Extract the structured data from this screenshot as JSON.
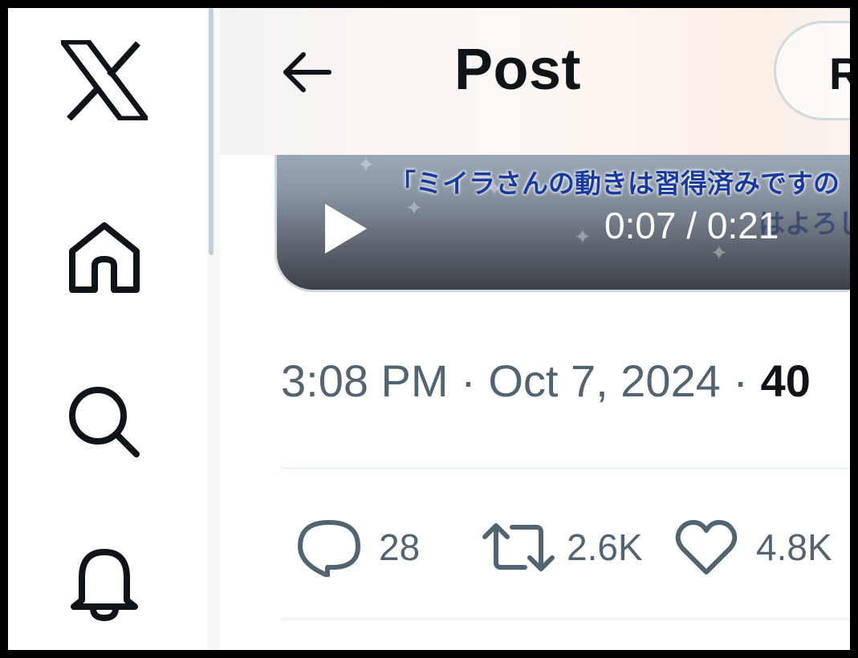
{
  "nav": {
    "logo": "x-logo-icon",
    "items": [
      {
        "name": "home",
        "icon": "home-icon"
      },
      {
        "name": "explore",
        "icon": "search-icon"
      },
      {
        "name": "notifications",
        "icon": "bell-icon"
      }
    ]
  },
  "header": {
    "title": "Post",
    "back_icon": "arrow-left-icon",
    "reply_button_label": "R"
  },
  "video": {
    "subtitle_line1": "「ミイラさんの動きは習得済みですの",
    "subtitle_line2": "はよろしい",
    "time": "0:07 / 0:21",
    "play_icon": "play-icon"
  },
  "post": {
    "time": "3:08 PM",
    "date": "Oct 7, 2024",
    "views_partial": "40"
  },
  "actions": {
    "reply_count": "28",
    "repost_count": "2.6K",
    "like_count": "4.8K"
  },
  "colors": {
    "text_primary": "#0f1419",
    "text_secondary": "#536471",
    "border": "#cfd9de"
  }
}
